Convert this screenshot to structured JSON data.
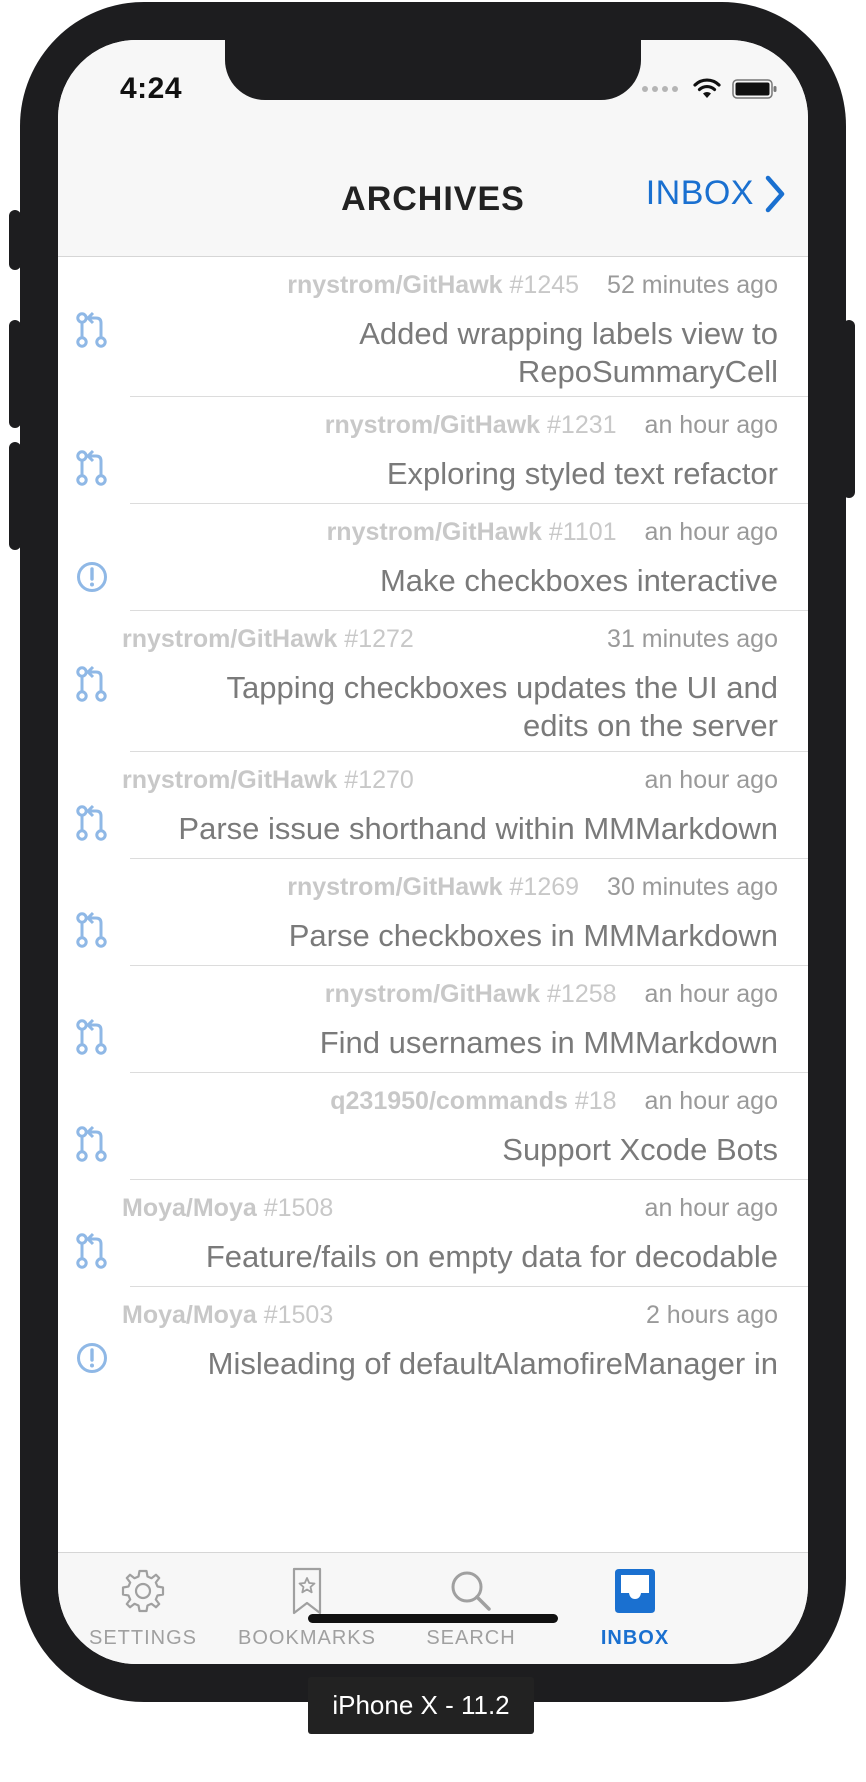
{
  "status": {
    "time": "4:24"
  },
  "nav": {
    "title": "ARCHIVES",
    "right_label": "INBOX"
  },
  "notifications": [
    {
      "type": "pull-request",
      "repo": "rnystrom/GitHawk",
      "number": "#1245",
      "time": "52 minutes ago",
      "title": "Added wrapping labels view to RepoSummaryCell"
    },
    {
      "type": "pull-request",
      "repo": "rnystrom/GitHawk",
      "number": "#1231",
      "time": "an hour ago",
      "title": "Exploring styled text refactor"
    },
    {
      "type": "issue",
      "repo": "rnystrom/GitHawk",
      "number": "#1101",
      "time": "an hour ago",
      "title": "Make checkboxes interactive"
    },
    {
      "type": "pull-request",
      "repo": "rnystrom/GitHawk",
      "number": "#1272",
      "time": "31 minutes ago",
      "title": "Tapping checkboxes updates the UI and edits on the server"
    },
    {
      "type": "pull-request",
      "repo": "rnystrom/GitHawk",
      "number": "#1270",
      "time": "an hour ago",
      "title": "Parse issue shorthand within MMMarkdown"
    },
    {
      "type": "pull-request",
      "repo": "rnystrom/GitHawk",
      "number": "#1269",
      "time": "30 minutes ago",
      "title": "Parse checkboxes in MMMarkdown"
    },
    {
      "type": "pull-request",
      "repo": "rnystrom/GitHawk",
      "number": "#1258",
      "time": "an hour ago",
      "title": "Find usernames in MMMarkdown"
    },
    {
      "type": "pull-request",
      "repo": "q231950/commands",
      "number": "#18",
      "time": "an hour ago",
      "title": "Support Xcode Bots"
    },
    {
      "type": "pull-request",
      "repo": "Moya/Moya",
      "number": "#1508",
      "time": "an hour ago",
      "title": "Feature/fails on empty data for decodable"
    },
    {
      "type": "issue",
      "repo": "Moya/Moya",
      "number": "#1503",
      "time": "2 hours ago",
      "title": "Misleading of defaultAlamofireManager in"
    }
  ],
  "tabs": [
    {
      "label": "SETTINGS",
      "icon": "gear-icon",
      "active": false
    },
    {
      "label": "BOOKMARKS",
      "icon": "bookmark-icon",
      "active": false
    },
    {
      "label": "SEARCH",
      "icon": "search-icon",
      "active": false
    },
    {
      "label": "INBOX",
      "icon": "inbox-icon",
      "active": true
    }
  ],
  "device_label": "iPhone X - 11.2",
  "colors": {
    "accent": "#1a70d0",
    "icon": "#8fb8e6",
    "meta": "#c8c8c8",
    "title": "#7a7a7a"
  }
}
